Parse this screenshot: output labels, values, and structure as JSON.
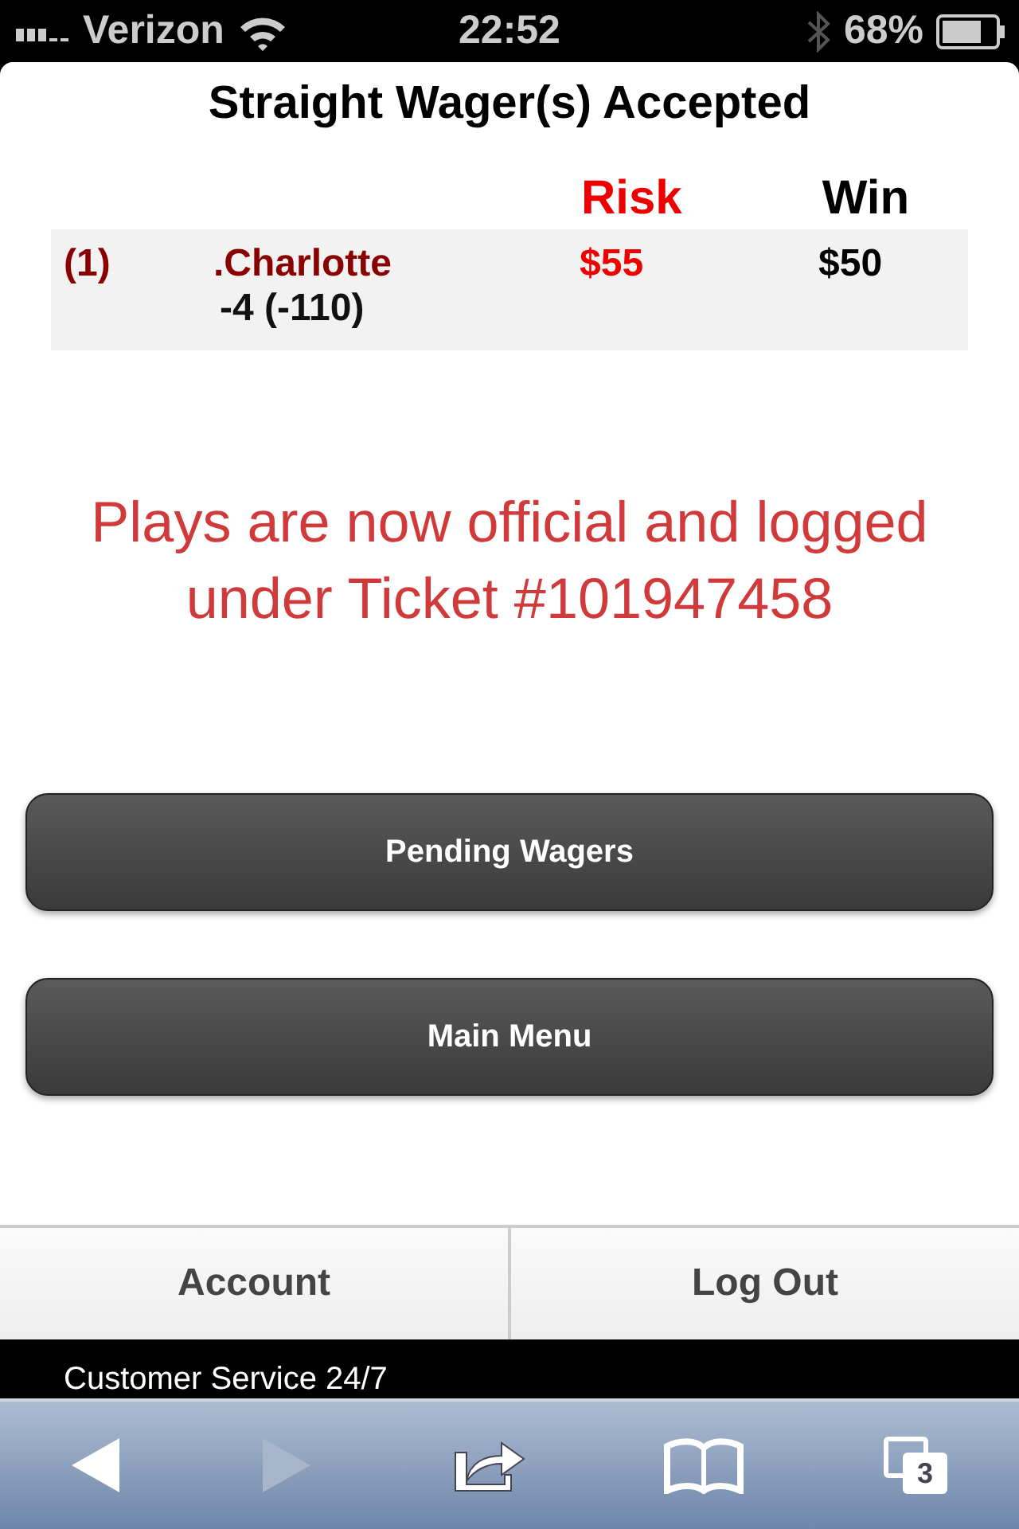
{
  "status_bar": {
    "carrier": "Verizon",
    "time": "22:52",
    "battery": "68%"
  },
  "title": "Straight Wager(s) Accepted",
  "columns": [
    "Risk",
    "Win"
  ],
  "rows": [
    {
      "number": "(1)",
      "team": ".Charlotte",
      "line": "-4 (-110)",
      "risk": "$55",
      "win": "$50"
    }
  ],
  "message": "Plays are now official and logged under Ticket #101947458",
  "buttons": [
    "Pending Wagers",
    "Main Menu"
  ],
  "footer_nav": [
    "Account",
    "Log Out"
  ],
  "footer_text": "Customer Service 24/7",
  "browser_toolbar": {
    "back_disabled": false,
    "forward_disabled": true,
    "tab_count": "3"
  }
}
